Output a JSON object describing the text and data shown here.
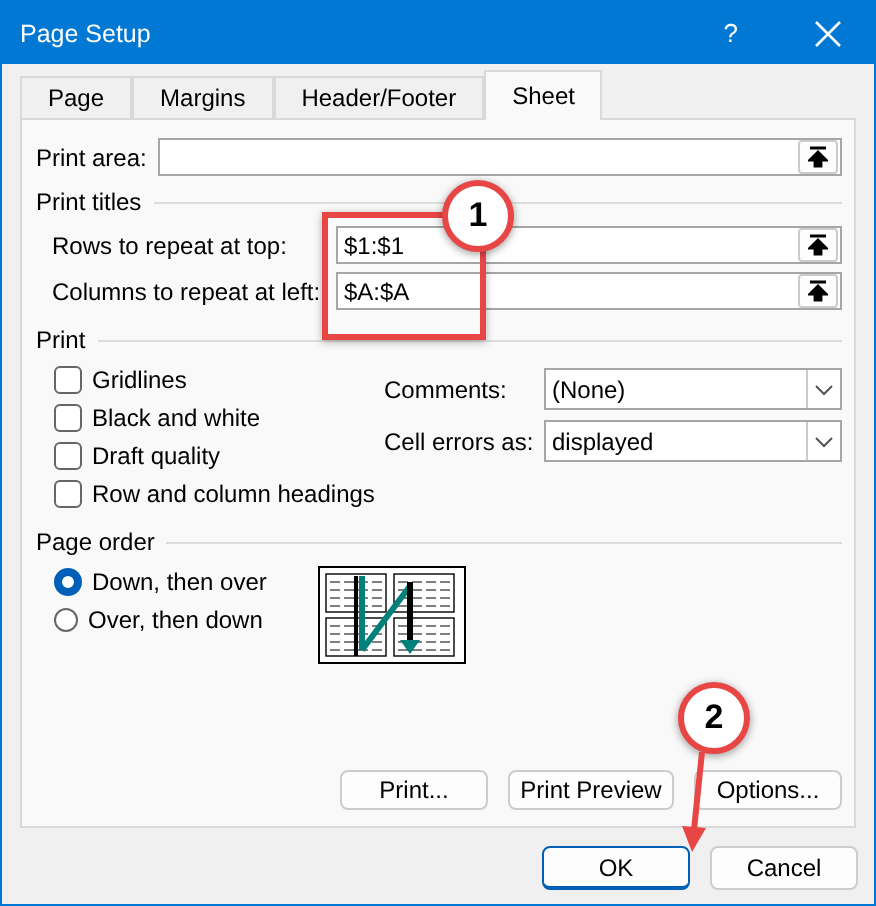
{
  "window": {
    "title": "Page Setup",
    "help": "?"
  },
  "tabs": [
    {
      "label": "Page",
      "selected": false
    },
    {
      "label": "Margins",
      "selected": false
    },
    {
      "label": "Header/Footer",
      "selected": false
    },
    {
      "label": "Sheet",
      "selected": true
    }
  ],
  "print_area": {
    "label": "Print area:"
  },
  "print_titles": {
    "heading": "Print titles",
    "fields": [
      {
        "label": "Rows to repeat at top:",
        "value": "$1:$1"
      },
      {
        "label": "Columns to repeat at left:",
        "value": "$A:$A"
      }
    ]
  },
  "print": {
    "heading": "Print",
    "checkboxes": [
      {
        "label": "Gridlines",
        "checked": false
      },
      {
        "label": "Black and white",
        "checked": false
      },
      {
        "label": "Draft quality",
        "checked": false
      },
      {
        "label": "Row and column headings",
        "checked": false
      }
    ],
    "selects": [
      {
        "label": "Comments:",
        "value": "(None)"
      },
      {
        "label": "Cell errors as:",
        "value": "displayed"
      }
    ]
  },
  "page_order": {
    "heading": "Page order",
    "options": [
      {
        "label": "Down, then over",
        "selected": true
      },
      {
        "label": "Over, then down",
        "selected": false
      }
    ]
  },
  "buttons": [
    "Print...",
    "Print Preview",
    "Options..."
  ],
  "footer_buttons": [
    {
      "label": "OK",
      "default": true
    },
    {
      "label": "Cancel",
      "default": false
    }
  ],
  "callouts": [
    "1",
    "2"
  ]
}
